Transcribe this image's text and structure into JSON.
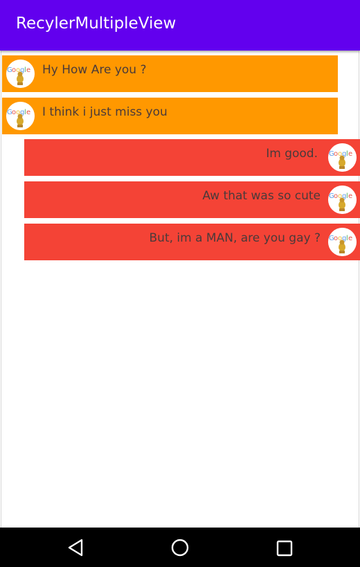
{
  "app_bar": {
    "title": "RecylerMultipleView",
    "color": "#6200ee"
  },
  "messages": [
    {
      "type": "received",
      "text": "Hy How Are you ?",
      "avatar": "google-doodle-avatar-icon"
    },
    {
      "type": "received",
      "text": "I think i just miss you",
      "avatar": "google-doodle-avatar-icon"
    },
    {
      "type": "sent",
      "text": "Im good.",
      "avatar": "google-doodle-avatar-icon"
    },
    {
      "type": "sent",
      "text": "Aw that was so cute",
      "avatar": "google-doodle-avatar-icon"
    },
    {
      "type": "sent",
      "text": "But, im a MAN, are you gay ?",
      "avatar": "google-doodle-avatar-icon"
    }
  ],
  "colors": {
    "received_bubble": "#ff9800",
    "sent_bubble": "#f44336"
  },
  "nav_bar": {
    "buttons": [
      "back-icon",
      "home-icon",
      "recents-icon"
    ]
  }
}
